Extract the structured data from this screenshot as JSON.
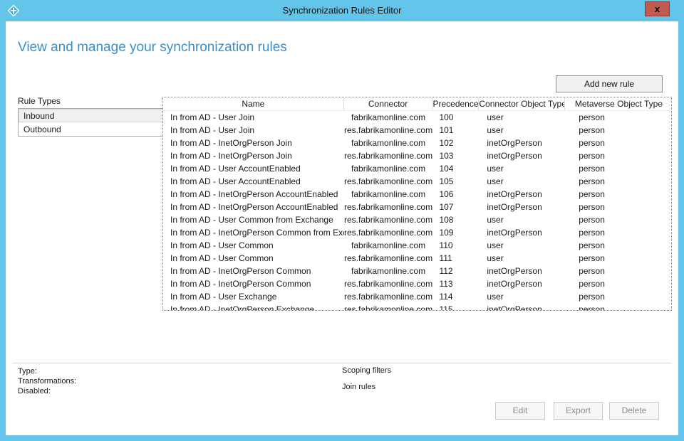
{
  "window": {
    "title": "Synchronization Rules Editor",
    "close_glyph": "x"
  },
  "header": {
    "heading": "View and manage your synchronization rules",
    "add_button_label": "Add new rule"
  },
  "rule_types": {
    "label": "Rule Types",
    "options": [
      {
        "label": "Inbound",
        "selected": true
      },
      {
        "label": "Outbound",
        "selected": false
      }
    ]
  },
  "table": {
    "columns": [
      "Name",
      "Connector",
      "Precedence",
      "Connector Object Type",
      "Metaverse Object Type"
    ],
    "rows": [
      [
        "In from AD - User Join",
        "fabrikamonline.com",
        "100",
        "user",
        "person"
      ],
      [
        "In from AD - User Join",
        "res.fabrikamonline.com",
        "101",
        "user",
        "person"
      ],
      [
        "In from AD - InetOrgPerson Join",
        "fabrikamonline.com",
        "102",
        "inetOrgPerson",
        "person"
      ],
      [
        "In from AD - InetOrgPerson Join",
        "res.fabrikamonline.com",
        "103",
        "inetOrgPerson",
        "person"
      ],
      [
        "In from AD - User AccountEnabled",
        "fabrikamonline.com",
        "104",
        "user",
        "person"
      ],
      [
        "In from AD - User AccountEnabled",
        "res.fabrikamonline.com",
        "105",
        "user",
        "person"
      ],
      [
        "In from AD - InetOrgPerson AccountEnabled",
        "fabrikamonline.com",
        "106",
        "inetOrgPerson",
        "person"
      ],
      [
        "In from AD - InetOrgPerson AccountEnabled",
        "res.fabrikamonline.com",
        "107",
        "inetOrgPerson",
        "person"
      ],
      [
        "In from AD - User Common from Exchange",
        "res.fabrikamonline.com",
        "108",
        "user",
        "person"
      ],
      [
        "In from AD - InetOrgPerson Common from Exchange",
        "res.fabrikamonline.com",
        "109",
        "inetOrgPerson",
        "person"
      ],
      [
        "In from AD - User Common",
        "fabrikamonline.com",
        "110",
        "user",
        "person"
      ],
      [
        "In from AD - User Common",
        "res.fabrikamonline.com",
        "111",
        "user",
        "person"
      ],
      [
        "In from AD - InetOrgPerson Common",
        "fabrikamonline.com",
        "112",
        "inetOrgPerson",
        "person"
      ],
      [
        "In from AD - InetOrgPerson Common",
        "res.fabrikamonline.com",
        "113",
        "inetOrgPerson",
        "person"
      ],
      [
        "In from AD - User Exchange",
        "res.fabrikamonline.com",
        "114",
        "user",
        "person"
      ],
      [
        "In from AD - InetOrgPerson Exchange",
        "res.fabrikamonline.com",
        "115",
        "inetOrgPerson",
        "person"
      ]
    ]
  },
  "details": {
    "type_label": "Type:",
    "transformations_label": "Transformations:",
    "disabled_label": "Disabled:",
    "scoping_filters_label": "Scoping filters",
    "join_rules_label": "Join rules"
  },
  "footer": {
    "edit_label": "Edit",
    "export_label": "Export",
    "delete_label": "Delete"
  },
  "colors": {
    "titlebar_blue": "#63c5e9",
    "heading_blue": "#3e8ec8",
    "close_red": "#c35a52"
  }
}
